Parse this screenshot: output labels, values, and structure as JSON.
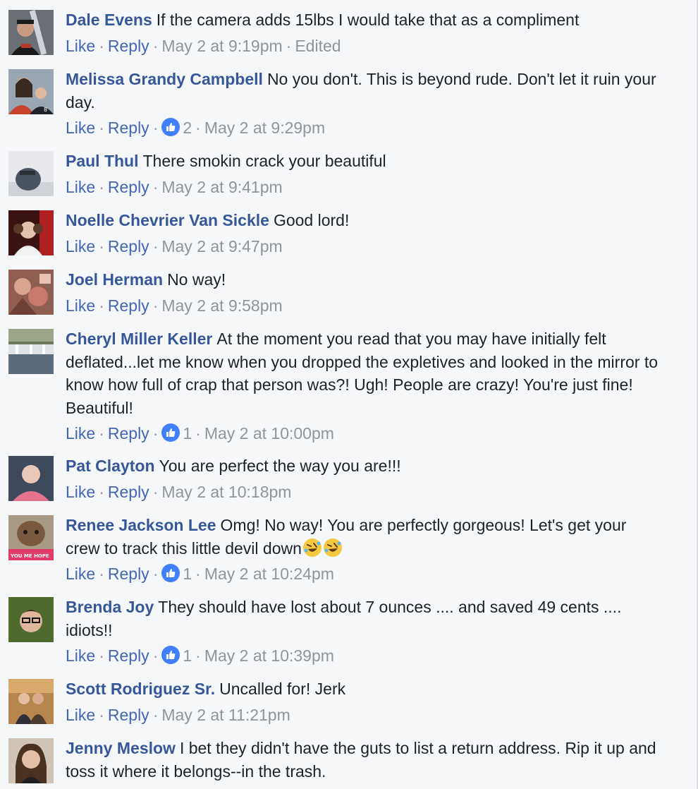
{
  "actions": {
    "like": "Like",
    "reply": "Reply",
    "separator": "·",
    "edited": "Edited"
  },
  "colors": {
    "author": "#365899",
    "link": "#4267b2",
    "meta": "#90949c",
    "text": "#1d2129",
    "background": "#f6f7f9",
    "like_badge": "#4080ff"
  },
  "comments": [
    {
      "author": "Dale Evens",
      "text": "If the camera adds 15lbs I would take that as a compliment",
      "timestamp": "May 2 at 9:19pm",
      "likes": "",
      "edited": true
    },
    {
      "author": "Melissa Grandy Campbell",
      "text": "No you don't. This is beyond rude. Don't let it ruin your day.",
      "timestamp": "May 2 at 9:29pm",
      "likes": "2",
      "edited": false
    },
    {
      "author": "Paul Thul",
      "text": "There smokin crack your beautiful",
      "timestamp": "May 2 at 9:41pm",
      "likes": "",
      "edited": false
    },
    {
      "author": "Noelle Chevrier Van Sickle",
      "text": "Good lord!",
      "timestamp": "May 2 at 9:47pm",
      "likes": "",
      "edited": false
    },
    {
      "author": "Joel Herman",
      "text": "No way!",
      "timestamp": "May 2 at 9:58pm",
      "likes": "",
      "edited": false
    },
    {
      "author": "Cheryl Miller Keller",
      "text": "At the moment you read that you may have initially felt deflated...let me know when you dropped the expletives and looked in the mirror to know how full of crap that person was?! Ugh! People are crazy! You're just fine! Beautiful!",
      "timestamp": "May 2 at 10:00pm",
      "likes": "1",
      "edited": false
    },
    {
      "author": "Pat Clayton",
      "text": "You are perfect the way you are!!!",
      "timestamp": "May 2 at 10:18pm",
      "likes": "",
      "edited": false
    },
    {
      "author": "Renee Jackson Lee",
      "text": "Omg! No way! You are perfectly gorgeous! Let's get your crew to track this little devil down",
      "timestamp": "May 2 at 10:24pm",
      "likes": "1",
      "edited": false,
      "emoji": "rolling-on-floor-laughing-emoji",
      "avatar_caption": "YOU ME HOPE"
    },
    {
      "author": "Brenda Joy",
      "text": "They should have lost about 7 ounces .... and saved 49 cents .... idiots!!",
      "timestamp": "May 2 at 10:39pm",
      "likes": "1",
      "edited": false
    },
    {
      "author": "Scott Rodriguez Sr.",
      "text": "Uncalled for! Jerk",
      "timestamp": "May 2 at 11:21pm",
      "likes": "",
      "edited": false
    },
    {
      "author": "Jenny Meslow",
      "text": "I bet they didn't have the guts to list a return address. Rip it up and toss it where it belongs--in the trash.",
      "timestamp": "",
      "likes": "",
      "edited": false
    }
  ]
}
